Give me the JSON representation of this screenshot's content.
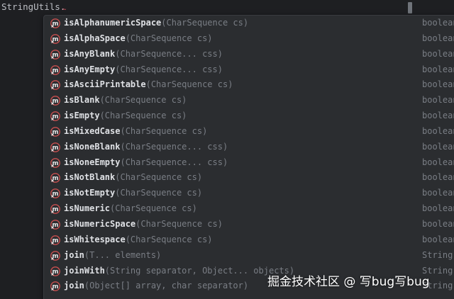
{
  "editor": {
    "code_text": "StringUtils.",
    "error_squiggle": "~"
  },
  "colors": {
    "background": "#1e1f22",
    "popup_background": "#2b2d30",
    "method_name": "#dfe1e5",
    "params": "#7a7e85",
    "icon_red": "#c94f4f"
  },
  "completion": {
    "icon": "method-icon",
    "items": [
      {
        "name": "isAlphanumericSpace",
        "params": "(CharSequence cs)",
        "type": "boolean"
      },
      {
        "name": "isAlphaSpace",
        "params": "(CharSequence cs)",
        "type": "boolean"
      },
      {
        "name": "isAnyBlank",
        "params": "(CharSequence... css)",
        "type": "boolean"
      },
      {
        "name": "isAnyEmpty",
        "params": "(CharSequence... css)",
        "type": "boolean"
      },
      {
        "name": "isAsciiPrintable",
        "params": "(CharSequence cs)",
        "type": "boolean"
      },
      {
        "name": "isBlank",
        "params": "(CharSequence cs)",
        "type": "boolean"
      },
      {
        "name": "isEmpty",
        "params": "(CharSequence cs)",
        "type": "boolean"
      },
      {
        "name": "isMixedCase",
        "params": "(CharSequence cs)",
        "type": "boolean"
      },
      {
        "name": "isNoneBlank",
        "params": "(CharSequence... css)",
        "type": "boolean"
      },
      {
        "name": "isNoneEmpty",
        "params": "(CharSequence... css)",
        "type": "boolean"
      },
      {
        "name": "isNotBlank",
        "params": "(CharSequence cs)",
        "type": "boolean"
      },
      {
        "name": "isNotEmpty",
        "params": "(CharSequence cs)",
        "type": "boolean"
      },
      {
        "name": "isNumeric",
        "params": "(CharSequence cs)",
        "type": "boolean"
      },
      {
        "name": "isNumericSpace",
        "params": "(CharSequence cs)",
        "type": "boolean"
      },
      {
        "name": "isWhitespace",
        "params": "(CharSequence cs)",
        "type": "boolean"
      },
      {
        "name": "join",
        "params": "(T... elements)",
        "type": "String"
      },
      {
        "name": "joinWith",
        "params": "(String separator, Object... objects)",
        "type": "String"
      },
      {
        "name": "join",
        "params": "(Object[] array, char separator)",
        "type": "String"
      }
    ]
  },
  "watermark": "掘金技术社区 @ 写bug写bug"
}
